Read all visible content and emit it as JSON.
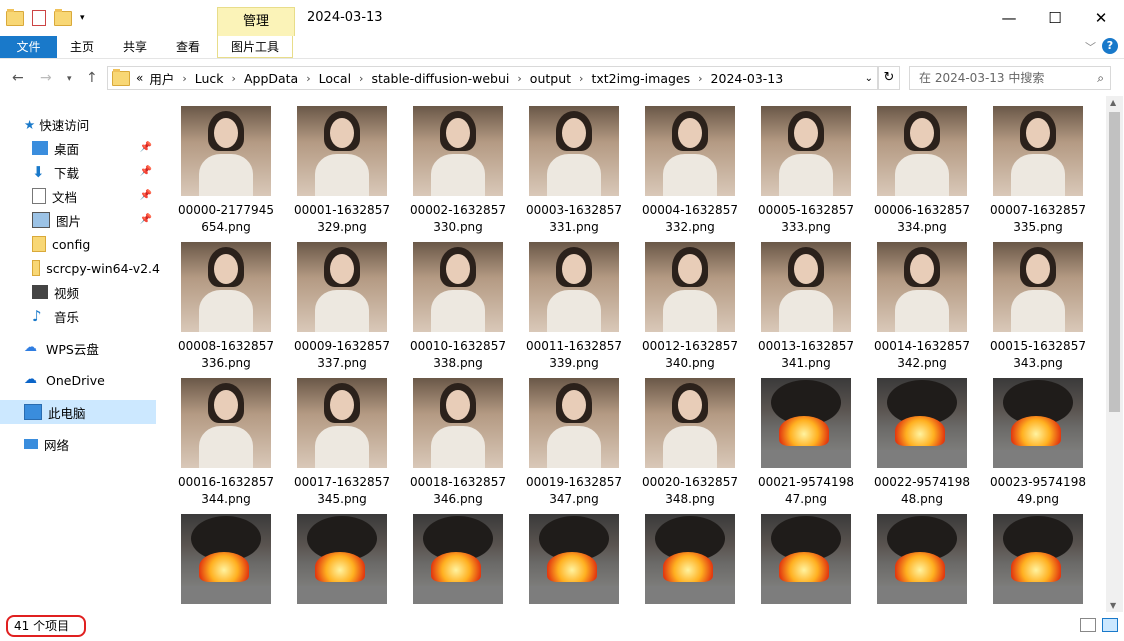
{
  "window": {
    "title": "2024-03-13",
    "contextual_tab": "管理",
    "controls": {
      "minimize": "—",
      "maximize": "☐",
      "close": "✕"
    }
  },
  "ribbon": {
    "tabs": [
      "文件",
      "主页",
      "共享",
      "查看",
      "图片工具"
    ]
  },
  "address": {
    "prefix": "«",
    "crumbs": [
      "用户",
      "Luck",
      "AppData",
      "Local",
      "stable-diffusion-webui",
      "output",
      "txt2img-images",
      "2024-03-13"
    ],
    "search_placeholder": "在 2024-03-13 中搜索"
  },
  "sidebar": {
    "quick_access": "快速访问",
    "items": [
      {
        "label": "桌面",
        "icon": "desktop-icon",
        "pinned": true
      },
      {
        "label": "下载",
        "icon": "download-icon",
        "pinned": true
      },
      {
        "label": "文档",
        "icon": "document-icon",
        "pinned": true
      },
      {
        "label": "图片",
        "icon": "picture-icon",
        "pinned": true
      },
      {
        "label": "config",
        "icon": "folder-icon",
        "pinned": false
      },
      {
        "label": "scrcpy-win64-v2.4",
        "icon": "folder-icon",
        "pinned": false
      },
      {
        "label": "视频",
        "icon": "video-icon",
        "pinned": false
      },
      {
        "label": "音乐",
        "icon": "music-icon",
        "pinned": false
      }
    ],
    "wps": "WPS云盘",
    "onedrive": "OneDrive",
    "thispc": "此电脑",
    "network": "网络"
  },
  "files": [
    {
      "name": "00000-2177945654.png",
      "kind": "portrait"
    },
    {
      "name": "00001-1632857329.png",
      "kind": "portrait"
    },
    {
      "name": "00002-1632857330.png",
      "kind": "portrait"
    },
    {
      "name": "00003-1632857331.png",
      "kind": "portrait"
    },
    {
      "name": "00004-1632857332.png",
      "kind": "portrait"
    },
    {
      "name": "00005-1632857333.png",
      "kind": "portrait"
    },
    {
      "name": "00006-1632857334.png",
      "kind": "portrait"
    },
    {
      "name": "00007-1632857335.png",
      "kind": "portrait"
    },
    {
      "name": "00008-1632857336.png",
      "kind": "portrait"
    },
    {
      "name": "00009-1632857337.png",
      "kind": "portrait"
    },
    {
      "name": "00010-1632857338.png",
      "kind": "portrait"
    },
    {
      "name": "00011-1632857339.png",
      "kind": "portrait"
    },
    {
      "name": "00012-1632857340.png",
      "kind": "portrait"
    },
    {
      "name": "00013-1632857341.png",
      "kind": "portrait"
    },
    {
      "name": "00014-1632857342.png",
      "kind": "portrait"
    },
    {
      "name": "00015-1632857343.png",
      "kind": "portrait"
    },
    {
      "name": "00016-1632857344.png",
      "kind": "portrait"
    },
    {
      "name": "00017-1632857345.png",
      "kind": "portrait"
    },
    {
      "name": "00018-1632857346.png",
      "kind": "portrait"
    },
    {
      "name": "00019-1632857347.png",
      "kind": "portrait"
    },
    {
      "name": "00020-1632857348.png",
      "kind": "portrait"
    },
    {
      "name": "00021-957419847.png",
      "kind": "fire"
    },
    {
      "name": "00022-957419848.png",
      "kind": "fire"
    },
    {
      "name": "00023-957419849.png",
      "kind": "fire"
    },
    {
      "name": "",
      "kind": "fire"
    },
    {
      "name": "",
      "kind": "fire"
    },
    {
      "name": "",
      "kind": "fire"
    },
    {
      "name": "",
      "kind": "fire"
    },
    {
      "name": "",
      "kind": "fire"
    },
    {
      "name": "",
      "kind": "fire"
    },
    {
      "name": "",
      "kind": "fire"
    },
    {
      "name": "",
      "kind": "fire"
    }
  ],
  "status": {
    "count": "41 个项目"
  }
}
